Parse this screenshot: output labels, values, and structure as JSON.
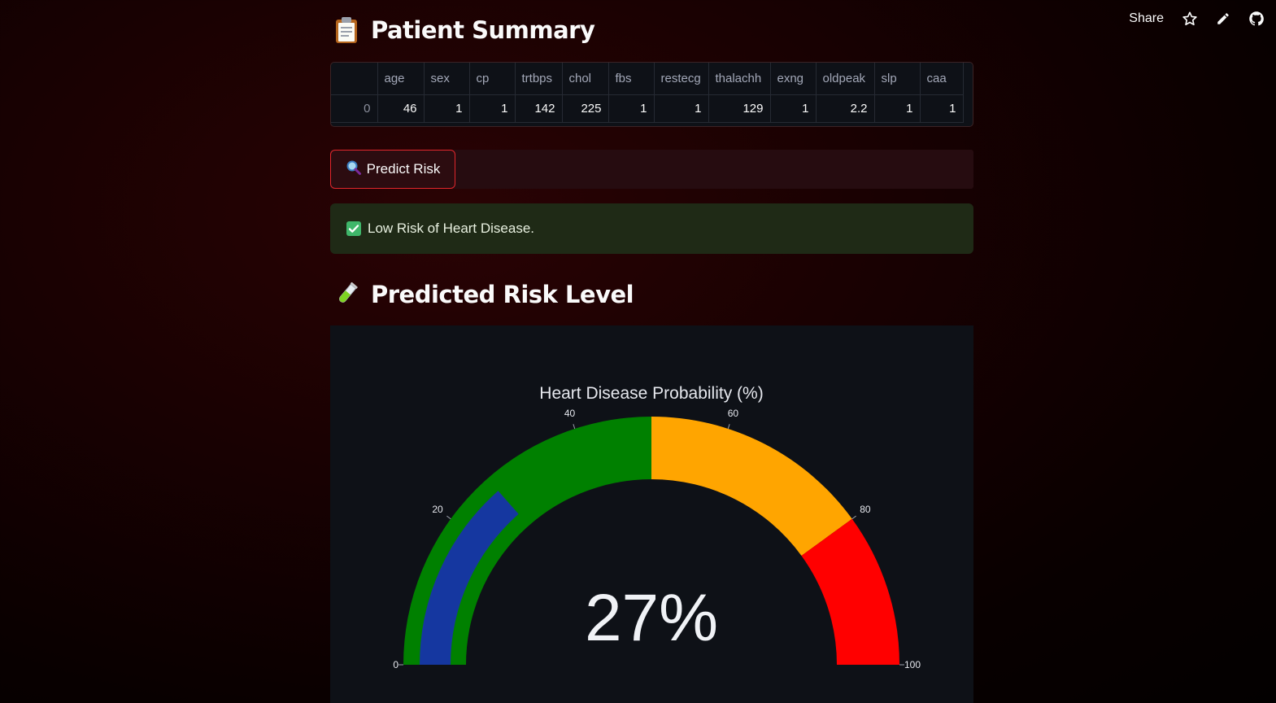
{
  "toolbar": {
    "share_label": "Share",
    "icons": [
      "star-icon",
      "pencil-icon",
      "github-icon"
    ]
  },
  "summary": {
    "title": "Patient Summary",
    "title_icon": "clipboard-icon",
    "columns": [
      "",
      "age",
      "sex",
      "cp",
      "trtbps",
      "chol",
      "fbs",
      "restecg",
      "thalachh",
      "exng",
      "oldpeak",
      "slp",
      "caa"
    ],
    "rows": [
      [
        "0",
        "46",
        "1",
        "1",
        "142",
        "225",
        "1",
        "1",
        "129",
        "1",
        "2.2",
        "1",
        "1"
      ]
    ]
  },
  "predict": {
    "button_label": "Predict Risk",
    "button_icon": "magnifier-icon"
  },
  "result": {
    "message": "Low Risk of Heart Disease.",
    "icon": "check-mark-icon",
    "color": "#1f2a16"
  },
  "risk": {
    "title": "Predicted Risk Level",
    "title_icon": "test-tube-icon"
  },
  "chart_data": {
    "type": "gauge",
    "title": "Heart Disease Probability (%)",
    "value": 27,
    "value_text": "27%",
    "range": [
      0,
      100
    ],
    "ticks": [
      0,
      20,
      40,
      60,
      80,
      100
    ],
    "steps": [
      {
        "range": [
          0,
          50
        ],
        "color": "#008000"
      },
      {
        "range": [
          50,
          80
        ],
        "color": "#ffa500"
      },
      {
        "range": [
          80,
          100
        ],
        "color": "#ff0000"
      }
    ],
    "bar_color": "#1537a0"
  },
  "colors": {
    "accent": "#e0262c",
    "panel": "#0e1117"
  }
}
